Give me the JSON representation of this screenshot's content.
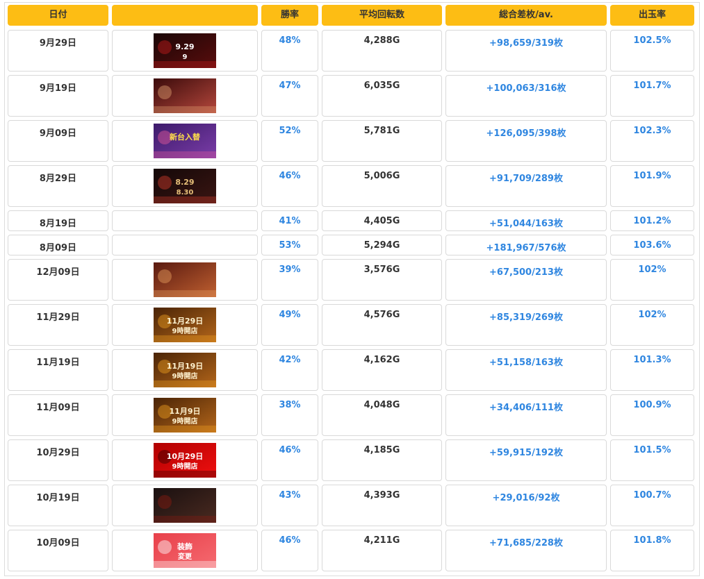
{
  "headers": {
    "date": "日付",
    "image": "",
    "win_rate": "勝率",
    "avg_spins": "平均回転数",
    "total_diff": "総合差枚/av.",
    "payout_rate": "出玉率"
  },
  "rows": [
    {
      "date": "9月29日",
      "win_rate": "48%",
      "avg_spins": "4,288G",
      "total_diff": "+98,659/319枚",
      "payout_rate": "102.5%",
      "thumb": {
        "style": "dark-red",
        "text1": "9.29",
        "text2": "9"
      }
    },
    {
      "date": "9月19日",
      "win_rate": "47%",
      "avg_spins": "6,035G",
      "total_diff": "+100,063/316枚",
      "payout_rate": "101.7%",
      "thumb": {
        "style": "woman-red",
        "text1": "",
        "text2": ""
      }
    },
    {
      "date": "9月09日",
      "win_rate": "52%",
      "avg_spins": "5,781G",
      "total_diff": "+126,095/398枚",
      "payout_rate": "102.3%",
      "thumb": {
        "style": "purple",
        "text1": "新台入替",
        "text2": ""
      }
    },
    {
      "date": "8月29日",
      "win_rate": "46%",
      "avg_spins": "5,006G",
      "total_diff": "+91,709/289枚",
      "payout_rate": "101.9%",
      "thumb": {
        "style": "dark-woman",
        "text1": "8.29",
        "text2": "8.30"
      }
    },
    {
      "date": "8月19日",
      "win_rate": "41%",
      "avg_spins": "4,405G",
      "total_diff": "+51,044/163枚",
      "payout_rate": "101.2%",
      "thumb": null
    },
    {
      "date": "8月09日",
      "win_rate": "53%",
      "avg_spins": "5,294G",
      "total_diff": "+181,967/576枚",
      "payout_rate": "103.6%",
      "thumb": null
    },
    {
      "date": "12月09日",
      "win_rate": "39%",
      "avg_spins": "3,576G",
      "total_diff": "+67,500/213枚",
      "payout_rate": "102%",
      "thumb": {
        "style": "blonde",
        "text1": "",
        "text2": ""
      }
    },
    {
      "date": "11月29日",
      "win_rate": "49%",
      "avg_spins": "4,576G",
      "total_diff": "+85,319/269枚",
      "payout_rate": "102%",
      "thumb": {
        "style": "autumn",
        "text1": "11月29日",
        "text2": "9時開店"
      }
    },
    {
      "date": "11月19日",
      "win_rate": "42%",
      "avg_spins": "4,162G",
      "total_diff": "+51,158/163枚",
      "payout_rate": "101.3%",
      "thumb": {
        "style": "autumn",
        "text1": "11月19日",
        "text2": "9時開店"
      }
    },
    {
      "date": "11月09日",
      "win_rate": "38%",
      "avg_spins": "4,048G",
      "total_diff": "+34,406/111枚",
      "payout_rate": "100.9%",
      "thumb": {
        "style": "autumn",
        "text1": "11月9日",
        "text2": "9時開店"
      }
    },
    {
      "date": "10月29日",
      "win_rate": "46%",
      "avg_spins": "4,185G",
      "total_diff": "+59,915/192枚",
      "payout_rate": "101.5%",
      "thumb": {
        "style": "red-dragon",
        "text1": "10月29日",
        "text2": "9時開店"
      }
    },
    {
      "date": "10月19日",
      "win_rate": "43%",
      "avg_spins": "4,393G",
      "total_diff": "+29,016/92枚",
      "payout_rate": "100.7%",
      "thumb": {
        "style": "dark-couple",
        "text1": "",
        "text2": ""
      }
    },
    {
      "date": "10月09日",
      "win_rate": "46%",
      "avg_spins": "4,211G",
      "total_diff": "+71,685/228枚",
      "payout_rate": "101.8%",
      "thumb": {
        "style": "pink",
        "text1": "装飾",
        "text2": "変更"
      }
    }
  ]
}
